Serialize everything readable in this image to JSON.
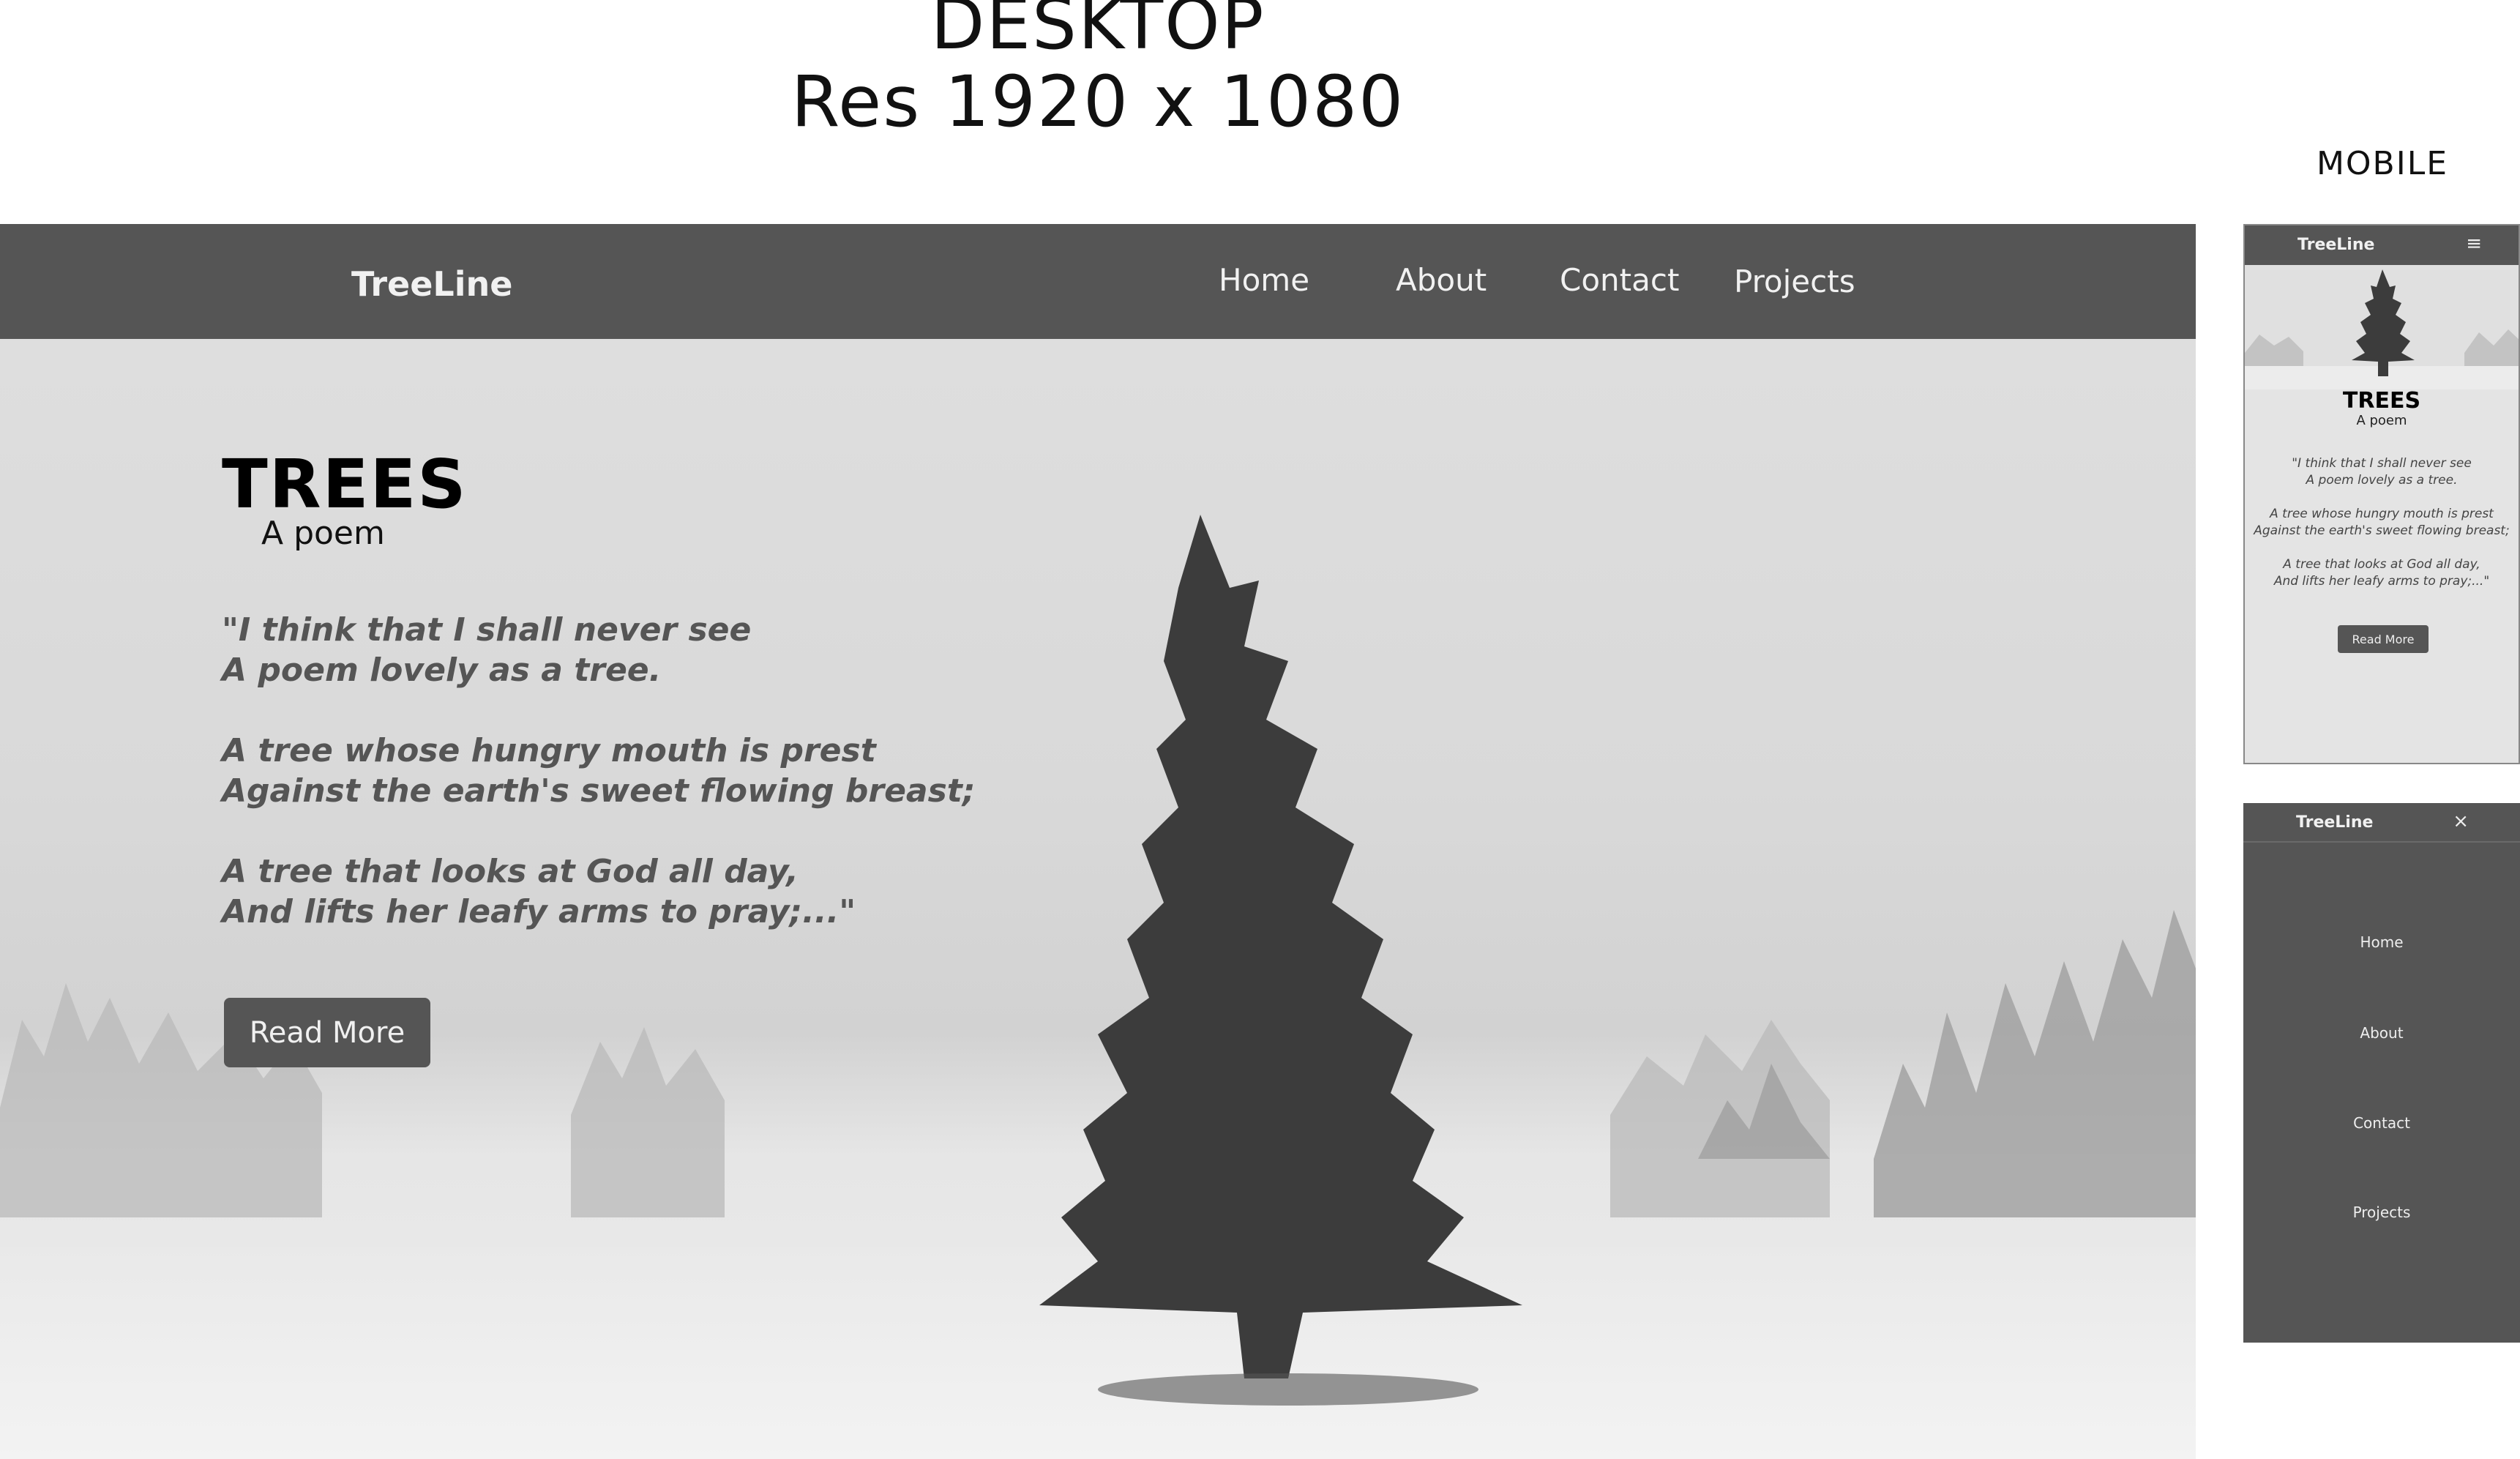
{
  "headings": {
    "desktop_line1": "DESKTOP",
    "desktop_line2": "Res 1920 x 1080",
    "mobile": "MOBILE"
  },
  "desktop": {
    "brand": "TreeLine",
    "nav": [
      "Home",
      "About",
      "Contact",
      "Projects"
    ],
    "title": "TREES",
    "subtitle": "A poem",
    "poem": [
      [
        "\"I think that I shall never see",
        "A poem lovely as a tree."
      ],
      [
        "A tree whose hungry mouth is prest",
        "Against the earth's sweet flowing breast;"
      ],
      [
        "A tree that looks at God all day,",
        "And lifts her leafy arms to pray;...\""
      ]
    ],
    "button": "Read More"
  },
  "mobile": {
    "brand": "TreeLine",
    "menu_icon": "hamburger-icon",
    "close_icon": "close-icon",
    "title": "TREES",
    "subtitle": "A poem",
    "poem": [
      [
        "\"I think that I shall never see",
        "A poem lovely as a tree."
      ],
      [
        "A tree whose hungry mouth is prest",
        "Against the earth's sweet flowing breast;"
      ],
      [
        "A tree that looks at God all day,",
        "And lifts her leafy arms to pray;...\""
      ]
    ],
    "button": "Read More",
    "menu_items": [
      "Home",
      "About",
      "Contact",
      "Projects"
    ]
  },
  "colors": {
    "nav_bg": "#555555",
    "hero_bg": "#dcdcdc",
    "text_dark": "#000000",
    "poem_text": "#555555"
  }
}
